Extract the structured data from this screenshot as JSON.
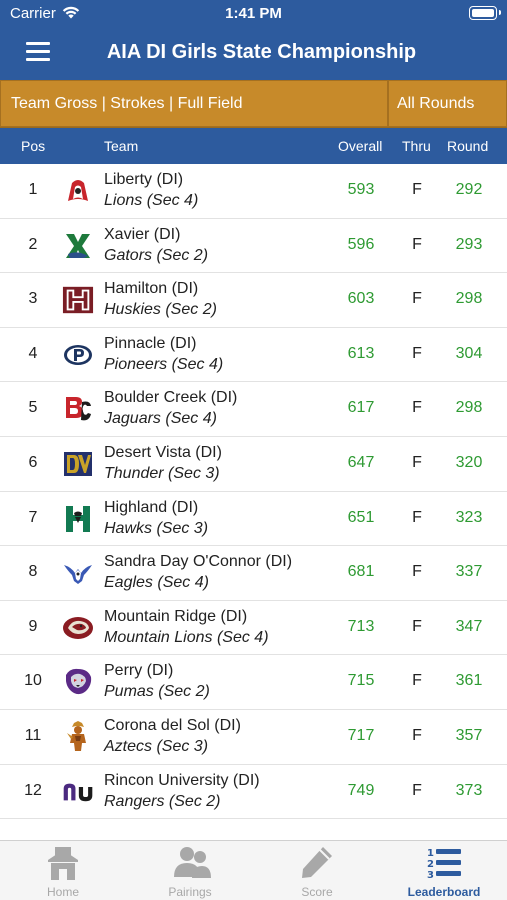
{
  "status": {
    "carrier": "Carrier",
    "time": "1:41 PM"
  },
  "header": {
    "title": "AIA DI Girls State Championship"
  },
  "filters": {
    "mode": "Team Gross | Strokes | Full Field",
    "rounds": "All Rounds"
  },
  "columns": {
    "pos": "Pos",
    "team": "Team",
    "overall": "Overall",
    "thru": "Thru",
    "round": "Round"
  },
  "colors": {
    "primary": "#2d5b9e",
    "accent": "#c78a2a",
    "score": "#2e9a32"
  },
  "teams": [
    {
      "pos": "1",
      "name": "Liberty (DI)",
      "mascot": "Lions (Sec 4)",
      "overall": "593",
      "thru": "F",
      "round": "292",
      "logo": "liberty-lion-logo"
    },
    {
      "pos": "2",
      "name": "Xavier (DI)",
      "mascot": "Gators (Sec 2)",
      "overall": "596",
      "thru": "F",
      "round": "293",
      "logo": "xavier-x-logo"
    },
    {
      "pos": "3",
      "name": "Hamilton (DI)",
      "mascot": "Huskies (Sec 2)",
      "overall": "603",
      "thru": "F",
      "round": "298",
      "logo": "hamilton-h-logo"
    },
    {
      "pos": "4",
      "name": "Pinnacle (DI)",
      "mascot": "Pioneers (Sec 4)",
      "overall": "613",
      "thru": "F",
      "round": "304",
      "logo": "pinnacle-p-logo"
    },
    {
      "pos": "5",
      "name": "Boulder Creek (DI)",
      "mascot": "Jaguars (Sec 4)",
      "overall": "617",
      "thru": "F",
      "round": "298",
      "logo": "boulder-creek-bc-logo"
    },
    {
      "pos": "6",
      "name": "Desert Vista (DI)",
      "mascot": "Thunder (Sec 3)",
      "overall": "647",
      "thru": "F",
      "round": "320",
      "logo": "desert-vista-dv-logo"
    },
    {
      "pos": "7",
      "name": "Highland (DI)",
      "mascot": "Hawks (Sec 3)",
      "overall": "651",
      "thru": "F",
      "round": "323",
      "logo": "highland-h-logo"
    },
    {
      "pos": "8",
      "name": "Sandra Day O'Connor (DI)",
      "mascot": "Eagles (Sec 4)",
      "overall": "681",
      "thru": "F",
      "round": "337",
      "logo": "oconnor-eagle-logo"
    },
    {
      "pos": "9",
      "name": "Mountain Ridge (DI)",
      "mascot": "Mountain Lions (Sec 4)",
      "overall": "713",
      "thru": "F",
      "round": "347",
      "logo": "mountain-ridge-lion-logo"
    },
    {
      "pos": "10",
      "name": "Perry (DI)",
      "mascot": "Pumas (Sec 2)",
      "overall": "715",
      "thru": "F",
      "round": "361",
      "logo": "perry-puma-logo"
    },
    {
      "pos": "11",
      "name": "Corona del Sol (DI)",
      "mascot": "Aztecs (Sec 3)",
      "overall": "717",
      "thru": "F",
      "round": "357",
      "logo": "corona-aztec-logo"
    },
    {
      "pos": "12",
      "name": "Rincon University (DI)",
      "mascot": "Rangers (Sec 2)",
      "overall": "749",
      "thru": "F",
      "round": "373",
      "logo": "rincon-ru-logo"
    }
  ],
  "tabs": [
    {
      "label": "Home",
      "icon": "home-icon"
    },
    {
      "label": "Pairings",
      "icon": "people-icon"
    },
    {
      "label": "Score",
      "icon": "pencil-icon"
    },
    {
      "label": "Leaderboard",
      "icon": "leaderboard-list-icon"
    }
  ]
}
